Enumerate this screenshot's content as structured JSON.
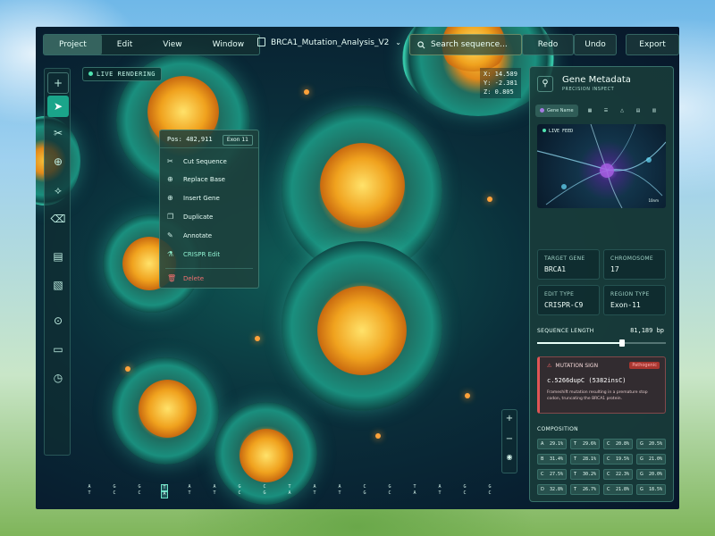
{
  "menu": {
    "items": [
      "Project",
      "Edit",
      "View",
      "Window"
    ]
  },
  "file": {
    "name": "BRCA1_Mutation_Analysis_V2"
  },
  "search": {
    "placeholder": "Search sequence..."
  },
  "toolbar": {
    "redo": "Redo",
    "undo": "Undo",
    "export": "Export"
  },
  "live_rendering": "LIVE RENDERING",
  "coords": {
    "x": "X: 14.589",
    "y": "Y: -2.381",
    "z": "Z: 0.805"
  },
  "context_menu": {
    "pos": "Pos: 482,911",
    "tag": "Exon 11",
    "items": [
      "Cut Sequence",
      "Replace Base",
      "Insert Gene",
      "Duplicate",
      "Annotate",
      "CRISPR Edit"
    ],
    "delete": "Delete"
  },
  "sequence": {
    "top": [
      "A",
      "G",
      "G",
      "T",
      "A",
      "A",
      "G",
      "C",
      "T",
      "A",
      "A",
      "C",
      "G",
      "T",
      "A",
      "G",
      "G"
    ],
    "bottom": [
      "T",
      "C",
      "C",
      "A",
      "T",
      "T",
      "C",
      "G",
      "A",
      "T",
      "T",
      "G",
      "C",
      "A",
      "T",
      "C",
      "C"
    ]
  },
  "panel": {
    "title": "Gene Metadata",
    "subtitle": "PRECISION INSPECT",
    "active_tab": "Gene Name",
    "feed_label": "LIVE FEED",
    "scale_label": "10nm",
    "target_gene_label": "TARGET GENE",
    "target_gene": "BRCA1",
    "chromosome_label": "CHROMOSOME",
    "chromosome": "17",
    "edit_type_label": "EDIT TYPE",
    "edit_type": "CRISPR-C9",
    "region_type_label": "REGION TYPE",
    "region_type": "Exon-11",
    "sequence_length_label": "SEQUENCE LENGTH",
    "sequence_length": "81,189 bp",
    "sequence_slider_fraction": 0.66,
    "mutation_title": "MUTATION SIGN",
    "mutation_badge": "Pathogenic",
    "mutation_code": "c.5266dupC (5382insC)",
    "mutation_desc": "Frameshift mutation resulting in a premature stop codon, truncating the BRCA1 protein.",
    "composition_title": "COMPOSITION",
    "composition": [
      [
        [
          "A",
          "29.1%"
        ],
        [
          "T",
          "29.6%"
        ],
        [
          "C",
          "20.8%"
        ],
        [
          "G",
          "20.5%"
        ]
      ],
      [
        [
          "B",
          "31.4%"
        ],
        [
          "T",
          "28.1%"
        ],
        [
          "C",
          "19.5%"
        ],
        [
          "G",
          "21.0%"
        ]
      ],
      [
        [
          "C",
          "27.5%"
        ],
        [
          "T",
          "30.2%"
        ],
        [
          "C",
          "22.3%"
        ],
        [
          "G",
          "20.0%"
        ]
      ],
      [
        [
          "D",
          "32.8%"
        ],
        [
          "T",
          "26.7%"
        ],
        [
          "C",
          "21.8%"
        ],
        [
          "G",
          "18.5%"
        ]
      ]
    ]
  }
}
